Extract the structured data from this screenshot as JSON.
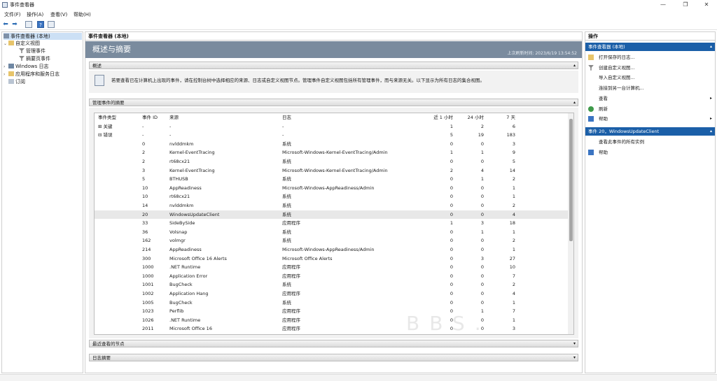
{
  "window": {
    "title": "事件查看器",
    "min": "—",
    "restore": "❐",
    "close": "✕"
  },
  "menu": [
    "文件(F)",
    "操作(A)",
    "查看(V)",
    "帮助(H)"
  ],
  "toolbar": {
    "back": "⬅",
    "forward": "➡"
  },
  "tree": [
    {
      "label": "事件查看器 (本地)",
      "level": 0,
      "toggle": "",
      "selected": true
    },
    {
      "label": "自定义视图",
      "level": 1,
      "toggle": "⌄",
      "selected": false
    },
    {
      "label": "管理事件",
      "level": 2,
      "toggle": "",
      "selected": false
    },
    {
      "label": "摘要页事件",
      "level": 2,
      "toggle": "",
      "selected": false
    },
    {
      "label": "Windows 日志",
      "level": 1,
      "toggle": "›",
      "selected": false
    },
    {
      "label": "应用程序和服务日志",
      "level": 1,
      "toggle": "›",
      "selected": false
    },
    {
      "label": "订阅",
      "level": 1,
      "toggle": "",
      "selected": false
    }
  ],
  "main": {
    "header": "事件查看器 (本地)",
    "banner_title": "概述与摘要",
    "last_refresh": "上次刷新时间: 2023/6/19 13:54:52",
    "overview_label": "概述",
    "overview_text": "若要查看已在计算机上出现的事件，请在控制台树中选择相应的来源、日志或自定义视图节点。管理事件自定义视图包括所有管理事件，而与来源无关。以下显示为所有日志的集合视图。",
    "summary_label": "管理事件的摘要",
    "recent_label": "最近查看的节点",
    "logsummary_label": "日志摘要",
    "collapse_chev": "▴",
    "expand_chev": "▾"
  },
  "table": {
    "headers": {
      "type": "事件类型",
      "id": "事件 ID",
      "source": "来源",
      "log": "日志",
      "h1": "近 1 小时",
      "h24": "24 小时",
      "d7": "7 天"
    },
    "rows": [
      {
        "type": "关键",
        "toggle": "⊞",
        "id": "-",
        "source": "-",
        "log": "-",
        "h1": "1",
        "h24": "2",
        "d7": "6"
      },
      {
        "type": "错误",
        "toggle": "⊟",
        "id": "-",
        "source": "-",
        "log": "-",
        "h1": "5",
        "h24": "19",
        "d7": "183"
      },
      {
        "type": "",
        "id": "0",
        "source": "nvlddmkm",
        "log": "系统",
        "h1": "0",
        "h24": "0",
        "d7": "3"
      },
      {
        "type": "",
        "id": "2",
        "source": "Kernel-EventTracing",
        "log": "Microsoft-Windows-Kernel-EventTracing/Admin",
        "h1": "1",
        "h24": "1",
        "d7": "9"
      },
      {
        "type": "",
        "id": "2",
        "source": "rt68cx21",
        "log": "系统",
        "h1": "0",
        "h24": "0",
        "d7": "5"
      },
      {
        "type": "",
        "id": "3",
        "source": "Kernel-EventTracing",
        "log": "Microsoft-Windows-Kernel-EventTracing/Admin",
        "h1": "2",
        "h24": "4",
        "d7": "14"
      },
      {
        "type": "",
        "id": "5",
        "source": "BTHUSB",
        "log": "系统",
        "h1": "0",
        "h24": "1",
        "d7": "2"
      },
      {
        "type": "",
        "id": "10",
        "source": "AppReadiness",
        "log": "Microsoft-Windows-AppReadiness/Admin",
        "h1": "0",
        "h24": "0",
        "d7": "1"
      },
      {
        "type": "",
        "id": "10",
        "source": "rt68cx21",
        "log": "系统",
        "h1": "0",
        "h24": "0",
        "d7": "1"
      },
      {
        "type": "",
        "id": "14",
        "source": "nvlddmkm",
        "log": "系统",
        "h1": "0",
        "h24": "0",
        "d7": "2"
      },
      {
        "type": "",
        "id": "20",
        "source": "WindowsUpdateClient",
        "log": "系统",
        "h1": "0",
        "h24": "0",
        "d7": "4",
        "highlight": true
      },
      {
        "type": "",
        "id": "33",
        "source": "SideBySide",
        "log": "应用程序",
        "h1": "1",
        "h24": "3",
        "d7": "18"
      },
      {
        "type": "",
        "id": "36",
        "source": "Volsnap",
        "log": "系统",
        "h1": "0",
        "h24": "1",
        "d7": "1"
      },
      {
        "type": "",
        "id": "162",
        "source": "volmgr",
        "log": "系统",
        "h1": "0",
        "h24": "0",
        "d7": "2"
      },
      {
        "type": "",
        "id": "214",
        "source": "AppReadiness",
        "log": "Microsoft-Windows-AppReadiness/Admin",
        "h1": "0",
        "h24": "0",
        "d7": "1"
      },
      {
        "type": "",
        "id": "300",
        "source": "Microsoft Office 16 Alerts",
        "log": "Microsoft Office Alerts",
        "h1": "0",
        "h24": "3",
        "d7": "27"
      },
      {
        "type": "",
        "id": "1000",
        "source": ".NET Runtime",
        "log": "应用程序",
        "h1": "0",
        "h24": "0",
        "d7": "10"
      },
      {
        "type": "",
        "id": "1000",
        "source": "Application Error",
        "log": "应用程序",
        "h1": "0",
        "h24": "0",
        "d7": "7"
      },
      {
        "type": "",
        "id": "1001",
        "source": "BugCheck",
        "log": "系统",
        "h1": "0",
        "h24": "0",
        "d7": "2"
      },
      {
        "type": "",
        "id": "1002",
        "source": "Application Hang",
        "log": "应用程序",
        "h1": "0",
        "h24": "0",
        "d7": "4"
      },
      {
        "type": "",
        "id": "1005",
        "source": "BugCheck",
        "log": "系统",
        "h1": "0",
        "h24": "0",
        "d7": "1"
      },
      {
        "type": "",
        "id": "1023",
        "source": "Perflib",
        "log": "应用程序",
        "h1": "0",
        "h24": "1",
        "d7": "7"
      },
      {
        "type": "",
        "id": "1026",
        "source": ".NET Runtime",
        "log": "应用程序",
        "h1": "0",
        "h24": "0",
        "d7": "1"
      },
      {
        "type": "",
        "id": "2011",
        "source": "Microsoft Office 16",
        "log": "应用程序",
        "h1": "0",
        "h24": "0",
        "d7": "3"
      }
    ]
  },
  "actions": {
    "header": "操作",
    "section1": "事件查看器 (本地)",
    "items1": [
      {
        "label": "打开保存的日志...",
        "icon": "open-folder-icon",
        "submenu": ""
      },
      {
        "label": "创建自定义视图...",
        "icon": "filter-icon",
        "submenu": ""
      },
      {
        "label": "导入自定义视图...",
        "icon": "",
        "submenu": ""
      },
      {
        "label": "连接到另一台计算机...",
        "icon": "",
        "submenu": ""
      },
      {
        "label": "查看",
        "icon": "",
        "submenu": "▸"
      },
      {
        "label": "刷新",
        "icon": "refresh-icon",
        "submenu": ""
      },
      {
        "label": "帮助",
        "icon": "help-icon",
        "submenu": "▸"
      }
    ],
    "section2": "事件 20，WindowsUpdateClient",
    "items2": [
      {
        "label": "查看此事件的所有实例",
        "icon": "",
        "submenu": ""
      },
      {
        "label": "帮助",
        "icon": "help-icon",
        "submenu": ""
      }
    ]
  },
  "watermark": "BBS.",
  "colors": {
    "banner": "#7a8b9e",
    "action_section": "#1b5fa8",
    "selection": "#cce0f5"
  }
}
